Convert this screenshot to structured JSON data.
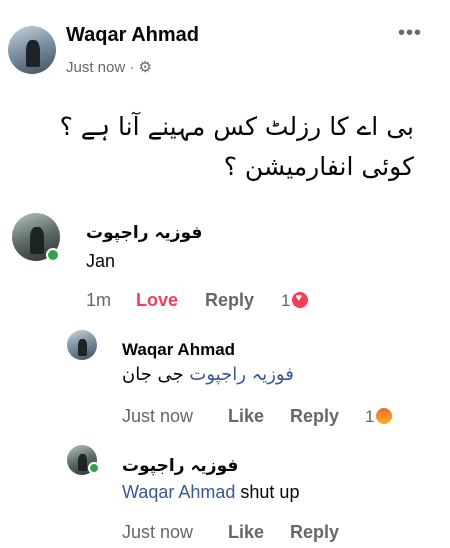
{
  "post": {
    "author": "Waqar Ahmad",
    "timestamp": "Just now",
    "separator": "·",
    "privacy_icon": "gear-icon",
    "more_label": "•••",
    "text_line1": "بی اے کا رزلٹ کس مہینے آنا ہے ؟",
    "text_line2": "کوئی انفارمیشن ؟"
  },
  "comments": [
    {
      "author": "فوزیہ راجپوت",
      "text": "Jan",
      "time": "1m",
      "reaction_label": "Love",
      "reply_label": "Reply",
      "reaction_count": "1",
      "reaction_icon": "heart-reaction-icon",
      "online": true
    },
    {
      "author": "Waqar Ahmad",
      "mention": "فوزیہ راجپوت",
      "text": "جی جان",
      "time": "Just now",
      "like_label": "Like",
      "reply_label": "Reply",
      "reaction_count": "1",
      "reaction_icon": "angry-reaction-icon"
    },
    {
      "author": "فوزیہ راجپوت",
      "mention": "Waqar Ahmad",
      "text": "shut up",
      "time": "Just now",
      "like_label": "Like",
      "reply_label": "Reply",
      "online": true
    }
  ],
  "colors": {
    "link": "#385898",
    "love": "#f33e58",
    "secondary_text": "#65676b",
    "online": "#31a24c"
  }
}
